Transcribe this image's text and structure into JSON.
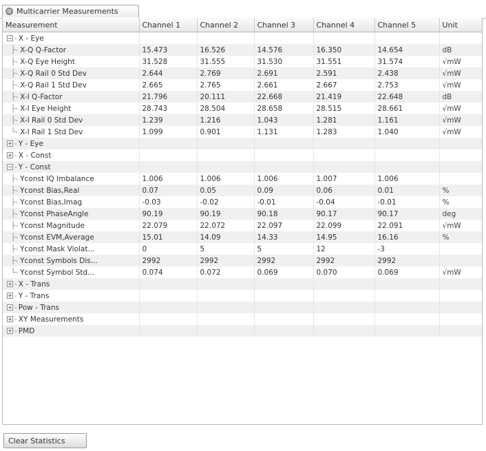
{
  "tab": {
    "title": "Multicarrier Measurements",
    "icon": "gear-icon"
  },
  "columns": [
    "Measurement",
    "Channel 1",
    "Channel 2",
    "Channel 3",
    "Channel 4",
    "Channel 5",
    "Unit"
  ],
  "rows": [
    {
      "type": "group",
      "expanded": true,
      "label": "X - Eye"
    },
    {
      "type": "item",
      "label": "X-Q Q-Factor",
      "values": [
        "15.473",
        "16.526",
        "14.576",
        "16.350",
        "14.654"
      ],
      "unit": "dB"
    },
    {
      "type": "item",
      "label": "X-Q Eye Height",
      "values": [
        "31.528",
        "31.555",
        "31.530",
        "31.551",
        "31.574"
      ],
      "unit": "√mW"
    },
    {
      "type": "item",
      "label": "X-Q Rail 0 Std Dev",
      "values": [
        "2.644",
        "2.769",
        "2.691",
        "2.591",
        "2.438"
      ],
      "unit": "√mW"
    },
    {
      "type": "item",
      "label": "X-Q Rail 1 Std Dev",
      "values": [
        "2.665",
        "2.765",
        "2.661",
        "2.667",
        "2.753"
      ],
      "unit": "√mW"
    },
    {
      "type": "item",
      "label": "X-I Q-Factor",
      "values": [
        "21.796",
        "20.111",
        "22.668",
        "21.419",
        "22.648"
      ],
      "unit": "dB"
    },
    {
      "type": "item",
      "label": "X-I Eye Height",
      "values": [
        "28.743",
        "28.504",
        "28.658",
        "28.515",
        "28.661"
      ],
      "unit": "√mW"
    },
    {
      "type": "item",
      "label": "X-I Rail 0 Std Dev",
      "values": [
        "1.239",
        "1.216",
        "1.043",
        "1.281",
        "1.161"
      ],
      "unit": "√mW"
    },
    {
      "type": "item",
      "label": "X-I Rail 1 Std Dev",
      "values": [
        "1.099",
        "0.901",
        "1.131",
        "1.283",
        "1.040"
      ],
      "unit": "√mW"
    },
    {
      "type": "group",
      "expanded": false,
      "label": "Y - Eye"
    },
    {
      "type": "group",
      "expanded": false,
      "label": "X - Const"
    },
    {
      "type": "group",
      "expanded": true,
      "label": "Y - Const"
    },
    {
      "type": "item",
      "label": "Yconst IQ Imbalance",
      "values": [
        "1.006",
        "1.006",
        "1.006",
        "1.007",
        "1.006"
      ],
      "unit": ""
    },
    {
      "type": "item",
      "label": "Yconst Bias,Real",
      "values": [
        "0.07",
        "0.05",
        "0.09",
        "0.06",
        "0.01"
      ],
      "unit": "%"
    },
    {
      "type": "item",
      "label": "Yconst Bias,Imag",
      "values": [
        "-0.03",
        "-0.02",
        "-0.01",
        "-0.04",
        "-0.01"
      ],
      "unit": "%"
    },
    {
      "type": "item",
      "label": "Yconst PhaseAngle",
      "values": [
        "90.19",
        "90.19",
        "90.18",
        "90.17",
        "90.17"
      ],
      "unit": "deg"
    },
    {
      "type": "item",
      "label": "Yconst Magnitude",
      "values": [
        "22.079",
        "22.072",
        "22.097",
        "22.099",
        "22.091"
      ],
      "unit": "√mW"
    },
    {
      "type": "item",
      "label": "Yconst EVM,Average",
      "values": [
        "15.01",
        "14.09",
        "14.33",
        "14.95",
        "16.16"
      ],
      "unit": "%"
    },
    {
      "type": "item",
      "label": "Yconst Mask Violat...",
      "values": [
        "0",
        "5",
        "5",
        "12",
        "-3"
      ],
      "unit": ""
    },
    {
      "type": "item",
      "label": "Yconst Symbols Dis...",
      "values": [
        "2992",
        "2992",
        "2992",
        "2992",
        "2992"
      ],
      "unit": ""
    },
    {
      "type": "item",
      "label": "Yconst Symbol Std...",
      "values": [
        "0.074",
        "0.072",
        "0.069",
        "0.070",
        "0.069"
      ],
      "unit": "√mW"
    },
    {
      "type": "group",
      "expanded": false,
      "label": "X - Trans"
    },
    {
      "type": "group",
      "expanded": false,
      "label": "Y - Trans"
    },
    {
      "type": "group",
      "expanded": false,
      "label": "Pow - Trans"
    },
    {
      "type": "group",
      "expanded": false,
      "label": "XY Measurements"
    },
    {
      "type": "group",
      "expanded": false,
      "label": "PMD"
    }
  ],
  "footer": {
    "clear_label": "Clear Statistics"
  }
}
